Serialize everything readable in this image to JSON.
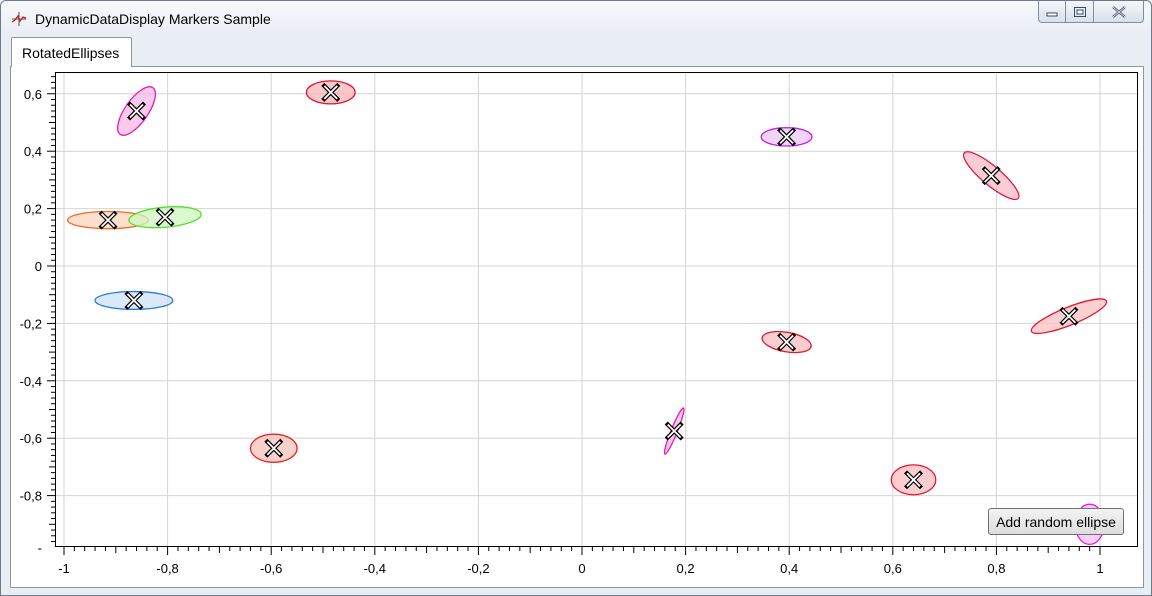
{
  "window": {
    "title": "DynamicDataDisplay Markers Sample",
    "app_icon": "chart-plot-icon",
    "caption_icons": [
      "minimize-icon",
      "restore-icon",
      "close-icon"
    ]
  },
  "tabs": [
    {
      "label": "RotatedEllipses",
      "selected": true
    }
  ],
  "add_button": {
    "label": "Add random ellipse"
  },
  "chart_data": {
    "type": "scatter",
    "title": "",
    "xlabel": "",
    "ylabel": "",
    "xlim": [
      -1,
      1
    ],
    "ylim": [
      -0.9,
      0.6
    ],
    "grid": true,
    "x_ticks": [
      "-1",
      "-0,8",
      "-0,6",
      "-0,4",
      "-0,2",
      "0",
      "0,2",
      "0,4",
      "0,6",
      "0,8",
      "1"
    ],
    "y_ticks": [
      "0,6",
      "0,4",
      "0,2",
      "0",
      "-0,2",
      "-0,4",
      "-0,6",
      "-0,8",
      "-"
    ],
    "marker": "x-cross-icon",
    "points": [
      {
        "x": -0.86,
        "y": 0.54,
        "rx": 0.055,
        "ry": 0.04,
        "angle": -55,
        "stroke": "#e020b0",
        "fill": "#f7b8e4"
      },
      {
        "x": -0.485,
        "y": 0.605,
        "rx": 0.047,
        "ry": 0.04,
        "angle": 0,
        "stroke": "#e0182c",
        "fill": "#f8b4b8"
      },
      {
        "x": -0.915,
        "y": 0.16,
        "rx": 0.078,
        "ry": 0.03,
        "angle": 0,
        "stroke": "#f06a20",
        "fill": "#fbd4bc"
      },
      {
        "x": -0.805,
        "y": 0.17,
        "rx": 0.07,
        "ry": 0.035,
        "angle": -5,
        "stroke": "#50e020",
        "fill": "#cff7bf"
      },
      {
        "x": -0.865,
        "y": -0.12,
        "rx": 0.075,
        "ry": 0.031,
        "angle": 0,
        "stroke": "#2a7ad8",
        "fill": "#cde0f6"
      },
      {
        "x": -0.595,
        "y": -0.635,
        "rx": 0.045,
        "ry": 0.049,
        "angle": 0,
        "stroke": "#e82820",
        "fill": "#f8c2bc"
      },
      {
        "x": 0.395,
        "y": 0.45,
        "rx": 0.049,
        "ry": 0.032,
        "angle": 0,
        "stroke": "#c020e8",
        "fill": "#ecc6f8"
      },
      {
        "x": 0.79,
        "y": 0.315,
        "rx": 0.068,
        "ry": 0.033,
        "angle": 40,
        "stroke": "#e01850",
        "fill": "#f8bcc8"
      },
      {
        "x": 0.395,
        "y": -0.265,
        "rx": 0.048,
        "ry": 0.034,
        "angle": 10,
        "stroke": "#e01830",
        "fill": "#f8bcc0"
      },
      {
        "x": 0.94,
        "y": -0.175,
        "rx": 0.078,
        "ry": 0.031,
        "angle": -22,
        "stroke": "#e01830",
        "fill": "#f8c0c4"
      },
      {
        "x": 0.178,
        "y": -0.575,
        "rx": 0.048,
        "ry": 0.011,
        "angle": -68,
        "stroke": "#e020b0",
        "fill": "#f4b6e0"
      },
      {
        "x": 0.64,
        "y": -0.745,
        "rx": 0.043,
        "ry": 0.052,
        "angle": 0,
        "stroke": "#e01830",
        "fill": "#f8bcc0"
      },
      {
        "x": 0.98,
        "y": -0.9,
        "rx": 0.028,
        "ry": 0.07,
        "angle": 0,
        "stroke": "#e020d8",
        "fill": "#f4c0f0"
      }
    ]
  }
}
